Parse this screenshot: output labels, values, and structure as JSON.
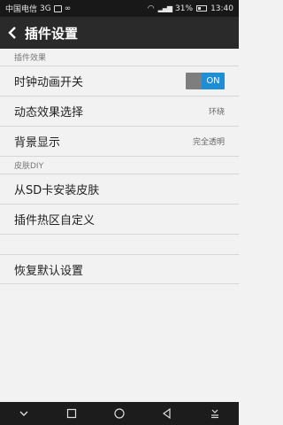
{
  "status_bar": {
    "carrier": "中国电信",
    "network": "3G",
    "battery": "31%",
    "time": "13:40"
  },
  "app_bar": {
    "title": "插件设置",
    "back_icon": "chevron-left-icon"
  },
  "sections": [
    {
      "header": "插件效果",
      "items": [
        {
          "label": "时钟动画开关",
          "toggle": "ON"
        },
        {
          "label": "动态效果选择",
          "value": "环绕"
        },
        {
          "label": "背景显示",
          "value": "完全透明"
        }
      ]
    },
    {
      "header": "皮肤DIY",
      "items": [
        {
          "label": "从SD卡安装皮肤"
        },
        {
          "label": "插件热区自定义"
        }
      ]
    },
    {
      "header": "",
      "items": [
        {
          "label": "恢复默认设置"
        }
      ]
    }
  ],
  "colors": {
    "accent": "#1e8fd6",
    "appbar": "#2a2a2a",
    "background": "#f2f2f2"
  },
  "nav_icons": [
    "dismiss-chevron-icon",
    "recent-apps-icon",
    "home-icon",
    "back-icon",
    "notification-pull-icon"
  ]
}
